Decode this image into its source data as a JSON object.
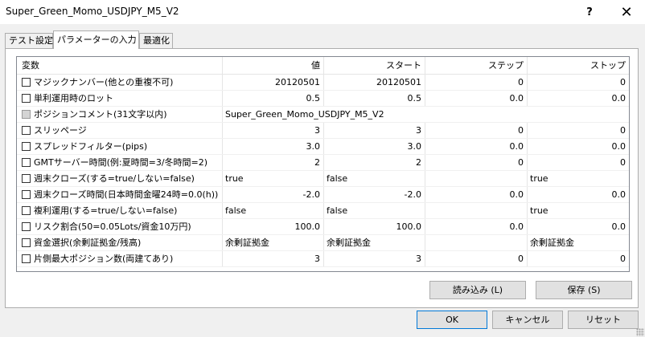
{
  "window": {
    "title": "Super_Green_Momo_USDJPY_M5_V2",
    "help_label": "?",
    "close_label": "✕"
  },
  "tabs": [
    {
      "label": "テスト設定"
    },
    {
      "label": "パラメーターの入力"
    },
    {
      "label": "最適化"
    }
  ],
  "grid": {
    "headers": [
      "変数",
      "値",
      "スタート",
      "ステップ",
      "ストップ"
    ],
    "rows": [
      {
        "label": "マジックナンバー(他との重複不可)",
        "value": "20120501",
        "start": "20120501",
        "step": "0",
        "stop": "0"
      },
      {
        "label": "単利運用時のロット",
        "value": "0.5",
        "start": "0.5",
        "step": "0.0",
        "stop": "0.0"
      },
      {
        "label": "ポジションコメント(31文字以内)",
        "value": "Super_Green_Momo_USDJPY_M5_V2",
        "start": "",
        "step": "",
        "stop": ""
      },
      {
        "label": "スリッページ",
        "value": "3",
        "start": "3",
        "step": "0",
        "stop": "0"
      },
      {
        "label": "スプレッドフィルター(pips)",
        "value": "3.0",
        "start": "3.0",
        "step": "0.0",
        "stop": "0.0"
      },
      {
        "label": "GMTサーバー時間(例:夏時間=3/冬時間=2)",
        "value": "2",
        "start": "2",
        "step": "0",
        "stop": "0"
      },
      {
        "label": "週末クローズ(する=true/しない=false)",
        "value": "true",
        "start": "false",
        "step": "",
        "stop": "true"
      },
      {
        "label": "週末クローズ時間(日本時間金曜24時=0.0(h))",
        "value": "-2.0",
        "start": "-2.0",
        "step": "0.0",
        "stop": "0.0"
      },
      {
        "label": "複利運用(する=true/しない=false)",
        "value": "false",
        "start": "false",
        "step": "",
        "stop": "true"
      },
      {
        "label": "リスク割合(50=0.05Lots/資金10万円)",
        "value": "100.0",
        "start": "100.0",
        "step": "0.0",
        "stop": "0.0"
      },
      {
        "label": "資金選択(余剰証拠金/残高)",
        "value": "余剰証拠金",
        "start": "余剰証拠金",
        "step": "",
        "stop": "余剰証拠金"
      },
      {
        "label": "片側最大ポジション数(両建てあり)",
        "value": "3",
        "start": "3",
        "step": "0",
        "stop": "0"
      }
    ]
  },
  "buttons": {
    "load": "読み込み (L)",
    "save": "保存 (S)",
    "ok": "OK",
    "cancel": "キャンセル",
    "reset": "リセット"
  }
}
